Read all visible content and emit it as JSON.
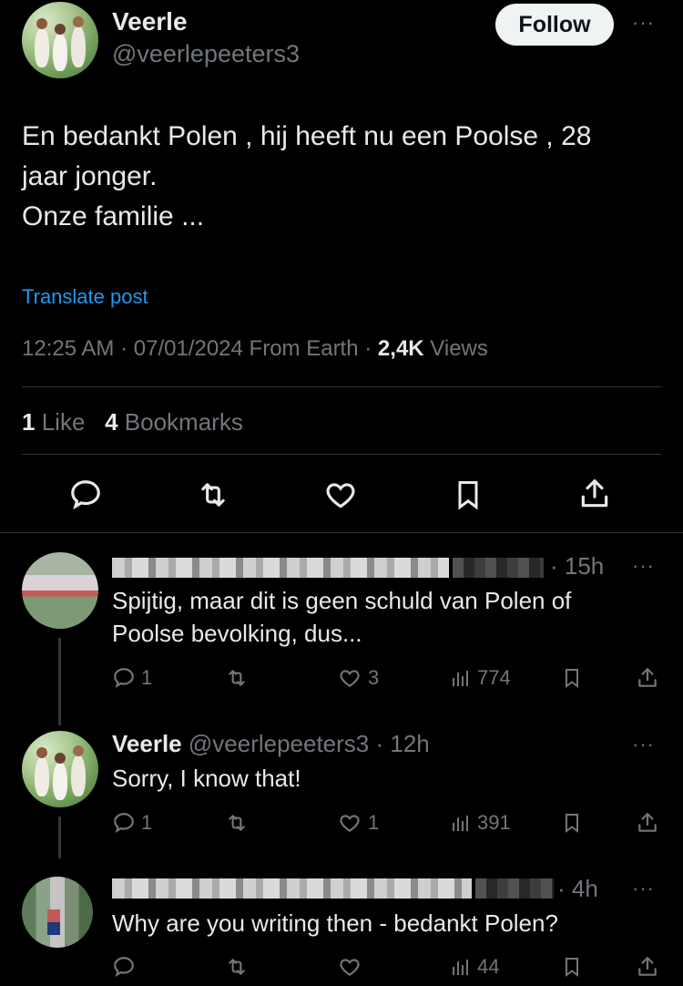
{
  "main_post": {
    "author_name": "Veerle",
    "author_handle": "@veerlepeeters3",
    "follow_label": "Follow",
    "more": "···",
    "text_line1": "En bedankt Polen , hij heeft nu een Poolse , 28",
    "text_line2": "jaar jonger.",
    "text_line3": "Onze familie ...",
    "translate": "Translate post",
    "time": "12:25 AM",
    "date": "07/01/2024",
    "source": "From Earth",
    "views_count": "2,4K",
    "views_label": "Views",
    "likes_count": "1",
    "likes_label": "Like",
    "bookmarks_count": "4",
    "bookmarks_label": "Bookmarks"
  },
  "replies": [
    {
      "time": "· 15h",
      "more": "···",
      "text_line1": "Spijtig, maar dit is geen schuld van Polen of",
      "text_line2": "Poolse bevolking, dus...",
      "reply_count": "1",
      "like_count": "3",
      "views": "774"
    },
    {
      "author_name": "Veerle",
      "author_handle": "@veerlepeeters3",
      "time": "· 12h",
      "more": "···",
      "text_line1": "Sorry, I know that!",
      "reply_count": "1",
      "like_count": "1",
      "views": "391"
    },
    {
      "time": "· 4h",
      "more": "···",
      "text_line1": "Why are you writing then - bedankt Polen?",
      "views": "44"
    }
  ],
  "colors": {
    "accent": "#1d9bf0",
    "background": "#000000",
    "muted": "#71767b",
    "divider": "#2f3336"
  }
}
